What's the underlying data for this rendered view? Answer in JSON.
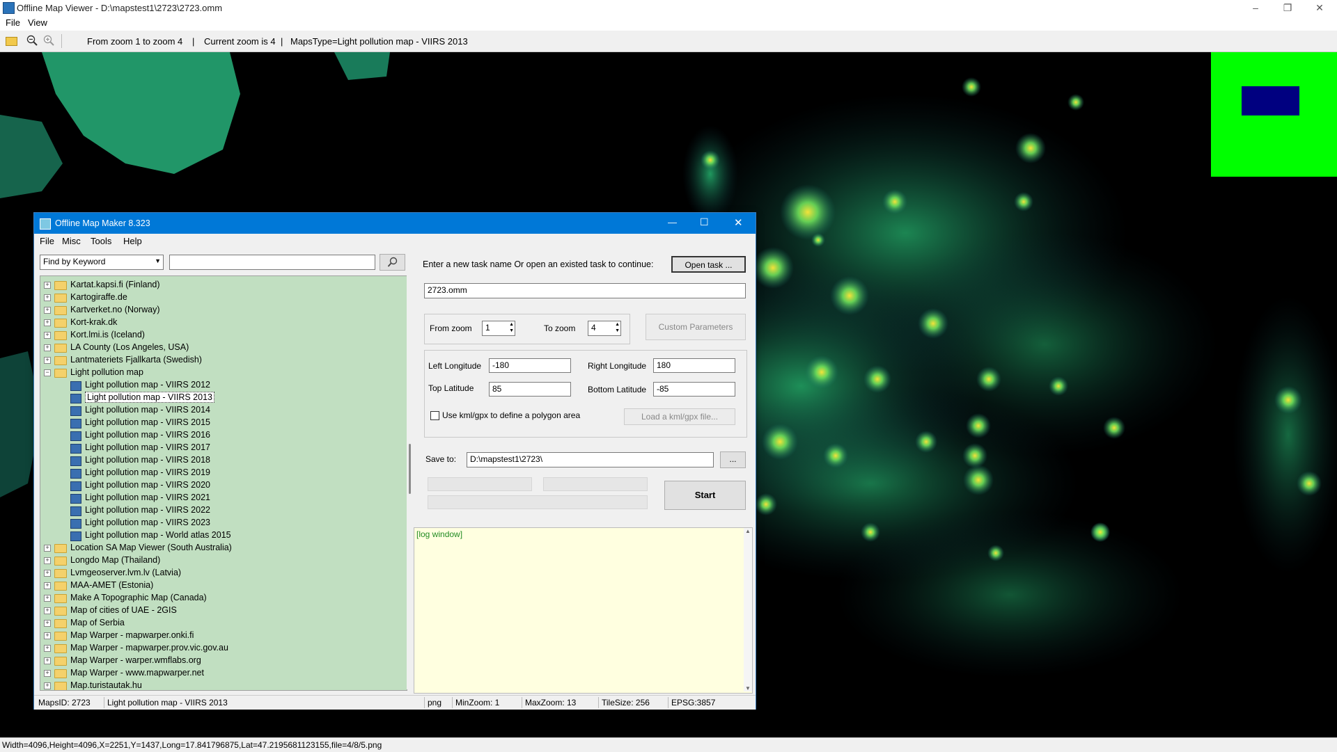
{
  "viewer": {
    "title": "Offline Map Viewer - D:\\mapstest1\\2723\\2723.omm",
    "menu": [
      "File",
      "View"
    ],
    "toolbar_info": {
      "zoom_range": "From zoom 1 to zoom 4",
      "current_zoom": "Current zoom is 4",
      "maps_type": "MapsType=Light pollution map - VIIRS 2013"
    },
    "icons": [
      "folder-open-icon",
      "zoom-out-icon",
      "zoom-in-icon"
    ],
    "status_text": "Width=4096,Height=4096,X=2251,Y=1437,Long=17.841796875,Lat=47.2195681123155,file=4/8/5.png",
    "window_controls": [
      "–",
      "❐",
      "✕"
    ]
  },
  "dialog": {
    "title": "Offline Map Maker 8.323",
    "window_controls": [
      "—",
      "☐",
      "✕"
    ],
    "menu": [
      "File",
      "Misc",
      "Tools",
      "Help"
    ],
    "search": {
      "mode": "Find by Keyword",
      "value": ""
    },
    "tree": [
      {
        "label": "Kartat.kapsi.fi (Finland)",
        "level": 0,
        "type": "folder"
      },
      {
        "label": "Kartogiraffe.de",
        "level": 0,
        "type": "folder"
      },
      {
        "label": "Kartverket.no (Norway)",
        "level": 0,
        "type": "folder"
      },
      {
        "label": "Kort-krak.dk",
        "level": 0,
        "type": "folder"
      },
      {
        "label": "Kort.lmi.is (Iceland)",
        "level": 0,
        "type": "folder"
      },
      {
        "label": "LA County (Los Angeles, USA)",
        "level": 0,
        "type": "folder"
      },
      {
        "label": "Lantmateriets Fjallkarta (Swedish)",
        "level": 0,
        "type": "folder"
      },
      {
        "label": "Light pollution map",
        "level": 0,
        "type": "folder-open"
      },
      {
        "label": "Light pollution map - VIIRS 2012",
        "level": 1,
        "type": "map"
      },
      {
        "label": "Light pollution map - VIIRS 2013",
        "level": 1,
        "type": "map",
        "selected": true
      },
      {
        "label": "Light pollution map - VIIRS 2014",
        "level": 1,
        "type": "map"
      },
      {
        "label": "Light pollution map - VIIRS 2015",
        "level": 1,
        "type": "map"
      },
      {
        "label": "Light pollution map - VIIRS 2016",
        "level": 1,
        "type": "map"
      },
      {
        "label": "Light pollution map - VIIRS 2017",
        "level": 1,
        "type": "map"
      },
      {
        "label": "Light pollution map - VIIRS 2018",
        "level": 1,
        "type": "map"
      },
      {
        "label": "Light pollution map - VIIRS 2019",
        "level": 1,
        "type": "map"
      },
      {
        "label": "Light pollution map - VIIRS 2020",
        "level": 1,
        "type": "map"
      },
      {
        "label": "Light pollution map - VIIRS 2021",
        "level": 1,
        "type": "map"
      },
      {
        "label": "Light pollution map - VIIRS 2022",
        "level": 1,
        "type": "map"
      },
      {
        "label": "Light pollution map - VIIRS 2023",
        "level": 1,
        "type": "map"
      },
      {
        "label": "Light pollution map - World atlas 2015",
        "level": 1,
        "type": "map"
      },
      {
        "label": "Location SA Map Viewer (South Australia)",
        "level": 0,
        "type": "folder"
      },
      {
        "label": "Longdo Map (Thailand)",
        "level": 0,
        "type": "folder"
      },
      {
        "label": "Lvmgeoserver.lvm.lv (Latvia)",
        "level": 0,
        "type": "folder"
      },
      {
        "label": "MAA-AMET (Estonia)",
        "level": 0,
        "type": "folder"
      },
      {
        "label": "Make A Topographic Map (Canada)",
        "level": 0,
        "type": "folder"
      },
      {
        "label": "Map of cities of UAE - 2GIS",
        "level": 0,
        "type": "folder"
      },
      {
        "label": "Map of Serbia",
        "level": 0,
        "type": "folder"
      },
      {
        "label": "Map Warper - mapwarper.onki.fi",
        "level": 0,
        "type": "folder"
      },
      {
        "label": "Map Warper - mapwarper.prov.vic.gov.au",
        "level": 0,
        "type": "folder"
      },
      {
        "label": "Map Warper - warper.wmflabs.org",
        "level": 0,
        "type": "folder"
      },
      {
        "label": "Map Warper - www.mapwarper.net",
        "level": 0,
        "type": "folder"
      },
      {
        "label": "Map.turistautak.hu",
        "level": 0,
        "type": "folder"
      }
    ],
    "task_prompt": "Enter a new task name Or open an existed task to continue:",
    "open_task_label": "Open task ...",
    "task_name": "2723.omm",
    "from_zoom_label": "From zoom",
    "from_zoom_value": "1",
    "to_zoom_label": "To zoom",
    "to_zoom_value": "4",
    "custom_params_label": "Custom Parameters",
    "left_lon_label": "Left Longitude",
    "left_lon_value": "-180",
    "right_lon_label": "Right Longitude",
    "right_lon_value": "180",
    "top_lat_label": "Top Latitude",
    "top_lat_value": "85",
    "bottom_lat_label": "Bottom Latitude",
    "bottom_lat_value": "-85",
    "kml_label": "Use kml/gpx to define a polygon area",
    "kml_checked": false,
    "load_kml_label": "Load a kml/gpx file...",
    "save_to_label": "Save to:",
    "save_to_value": "D:\\mapstest1\\2723\\",
    "browse_label": "...",
    "start_label": "Start",
    "log_label": "[log window]",
    "status": {
      "maps_id": "MapsID: 2723",
      "name": "Light pollution map - VIIRS 2013",
      "format": "png",
      "min_zoom": "MinZoom: 1",
      "max_zoom": "MaxZoom: 13",
      "tile_size": "TileSize: 256",
      "epsg": "EPSG:3857"
    }
  },
  "colors": {
    "accent": "#0078d7",
    "tree_bg": "#c1dfc1",
    "log_bg": "#ffffe0",
    "map_bg": "#000000",
    "light_glow": "#2fe08a",
    "light_core": "#f5e23a",
    "overview_green": "#00ff00",
    "overview_viewport": "#000080"
  }
}
